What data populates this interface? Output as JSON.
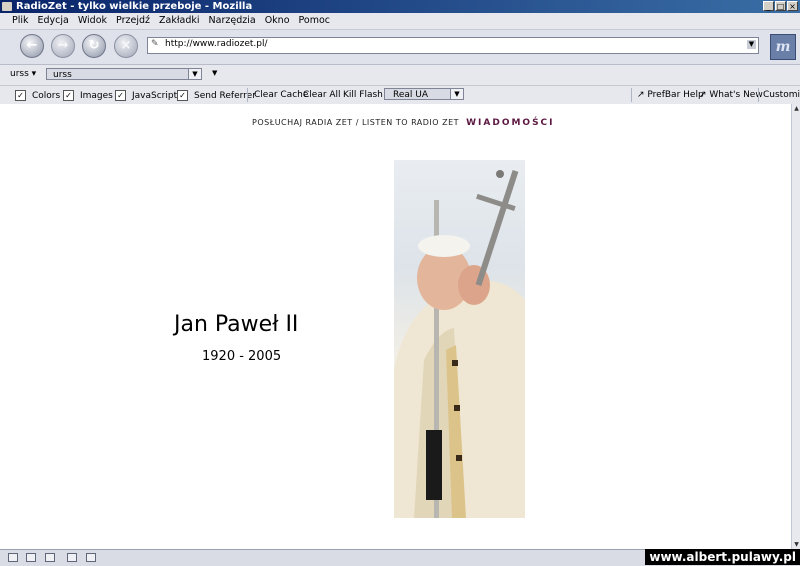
{
  "window": {
    "title": "RadioZet - tylko wielkie przeboje - Mozilla",
    "buttons": [
      "_",
      "□",
      "×"
    ]
  },
  "menu": {
    "items": [
      "Plik",
      "Edycja",
      "Widok",
      "Przejdź",
      "Zakładki",
      "Narzędzia",
      "Okno",
      "Pomoc"
    ]
  },
  "navigation": {
    "back_icon": "back-arrow-icon",
    "forward_icon": "forward-arrow-icon",
    "reload_icon": "reload-icon",
    "stop_icon": "stop-icon",
    "url": "http://www.radiozet.pl/"
  },
  "personal_toolbar": {
    "profile_label": "urss",
    "select_value": "urss"
  },
  "prefbar": {
    "checkboxes": [
      {
        "label": "Colors",
        "checked": true
      },
      {
        "label": "Images",
        "checked": true
      },
      {
        "label": "JavaScript",
        "checked": true
      },
      {
        "label": "Send Referrer",
        "checked": true
      }
    ],
    "buttons": [
      "Clear Cache",
      "Clear All",
      "Kill Flash"
    ],
    "ua_value": "Real UA",
    "right_buttons": [
      "PrefBar Help",
      "What's New",
      "Customize"
    ]
  },
  "page": {
    "header_text": "POSŁUCHAJ RADIA ZET / LISTEN TO RADIO ZET",
    "header_link": "WIADOMOŚCI",
    "name": "Jan Paweł II",
    "years": "1920 - 2005"
  },
  "watermark": "www.albert.pulawy.pl",
  "colors": {
    "titlebar": "#0a246a",
    "toolbar": "#e6e8ee",
    "news_link": "#5b1740"
  }
}
